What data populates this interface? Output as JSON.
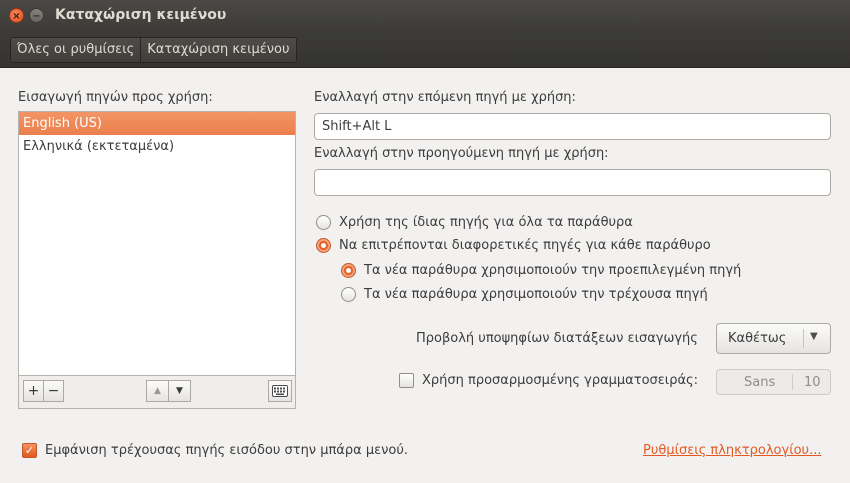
{
  "window": {
    "title": "Καταχώριση κειμένου",
    "close_glyph": "×",
    "minimize_glyph": "−"
  },
  "breadcrumb": {
    "items": [
      "Όλες οι ρυθμίσεις",
      "Καταχώριση κειμένου"
    ]
  },
  "sources": {
    "heading": "Εισαγωγή πηγών προς χρήση:",
    "items": [
      "English (US)",
      "Ελληνικά (εκτεταμένα)"
    ],
    "selected_index": 0,
    "toolbar": {
      "add": "+",
      "remove": "−",
      "up": "▲",
      "down": "▼",
      "keyboard_icon": "keyboard-icon"
    }
  },
  "shortcuts": {
    "next_label": "Εναλλαγή στην επόμενη πηγή με χρήση:",
    "next_value": "Shift+Alt L",
    "prev_label": "Εναλλαγή στην προηγούμενη πηγή με χρήση:",
    "prev_value": ""
  },
  "options": {
    "same_source": "Χρήση της ίδιας πηγής για όλα τα παράθυρα",
    "different_sources": "Να επιτρέπονται διαφορετικές πηγές για κάθε παράθυρο",
    "new_default": "Τα νέα παράθυρα χρησιμοποιούν την προεπιλεγμένη πηγή",
    "new_current": "Τα νέα παράθυρα χρησιμοποιούν την τρέχουσα πηγή"
  },
  "candidates": {
    "label": "Προβολή υποψηφίων διατάξεων εισαγωγής",
    "value": "Καθέτως",
    "arrow": "▼"
  },
  "custom_font": {
    "label": "Χρήση προσαρμοσμένης γραμματοσειράς:",
    "checked": false,
    "font_name": "Sans",
    "font_size": "10"
  },
  "show_menu": {
    "label": "Εμφάνιση τρέχουσας πηγής εισόδου στην μπάρα μενού.",
    "checked": true,
    "check_glyph": "✓"
  },
  "keyboard_link": "Ρυθμίσεις πληκτρολογίου...",
  "colors": {
    "accent": "#e95420",
    "window_title_bg": "#3c3b37",
    "body_bg": "#f2f1f0"
  }
}
